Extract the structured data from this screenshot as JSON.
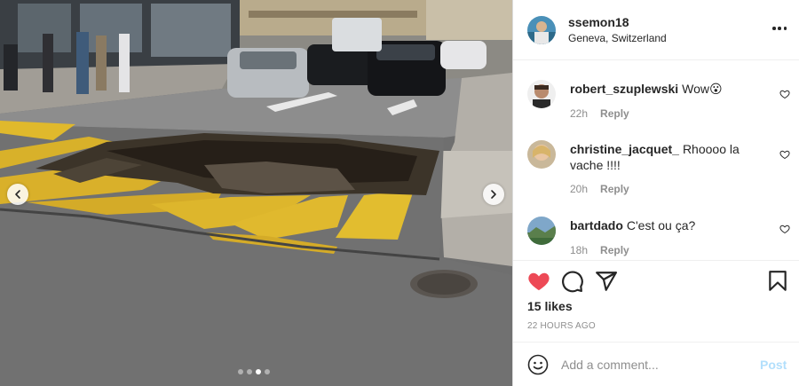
{
  "media": {
    "description_icon": "photo",
    "carousel": {
      "dot_count": 4,
      "active_index": 2
    }
  },
  "post": {
    "username": "ssemon18",
    "location": "Geneva, Switzerland"
  },
  "comments": [
    {
      "username": "robert_szuplewski",
      "text": "Wow😮",
      "age": "22h",
      "reply_label": "Reply"
    },
    {
      "username": "christine_jacquet_",
      "text": "Rhoooo la vache !!!!",
      "age": "20h",
      "reply_label": "Reply"
    },
    {
      "username": "bartdado",
      "text": "C'est ou ça?",
      "age": "18h",
      "reply_label": "Reply"
    }
  ],
  "actions": {
    "likes": "15 likes",
    "timestamp": "22 HOURS AGO",
    "like_color": "#ed4956"
  },
  "composer": {
    "placeholder": "Add a comment...",
    "post_label": "Post"
  },
  "colors": {
    "username": "#262626",
    "muted": "#8e8e8e",
    "post_disabled": "#b2dffc"
  }
}
